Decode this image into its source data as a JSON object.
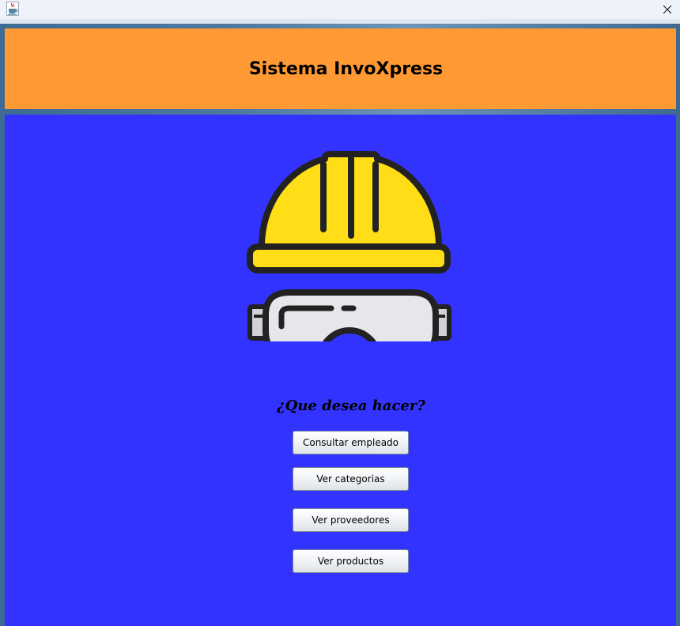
{
  "window": {
    "app_icon": "java-cup-icon",
    "close_icon": "close-icon"
  },
  "header": {
    "title": "Sistema InvoXpress",
    "background": "#ff9933"
  },
  "main": {
    "background": "#3333ff",
    "hero_icon": "hardhat-goggles-icon",
    "question": "¿Que desea hacer?",
    "buttons": [
      {
        "label": "Consultar empleado"
      },
      {
        "label": "Ver categorias"
      },
      {
        "label": "Ver proveedores"
      },
      {
        "label": "Ver productos"
      }
    ]
  }
}
